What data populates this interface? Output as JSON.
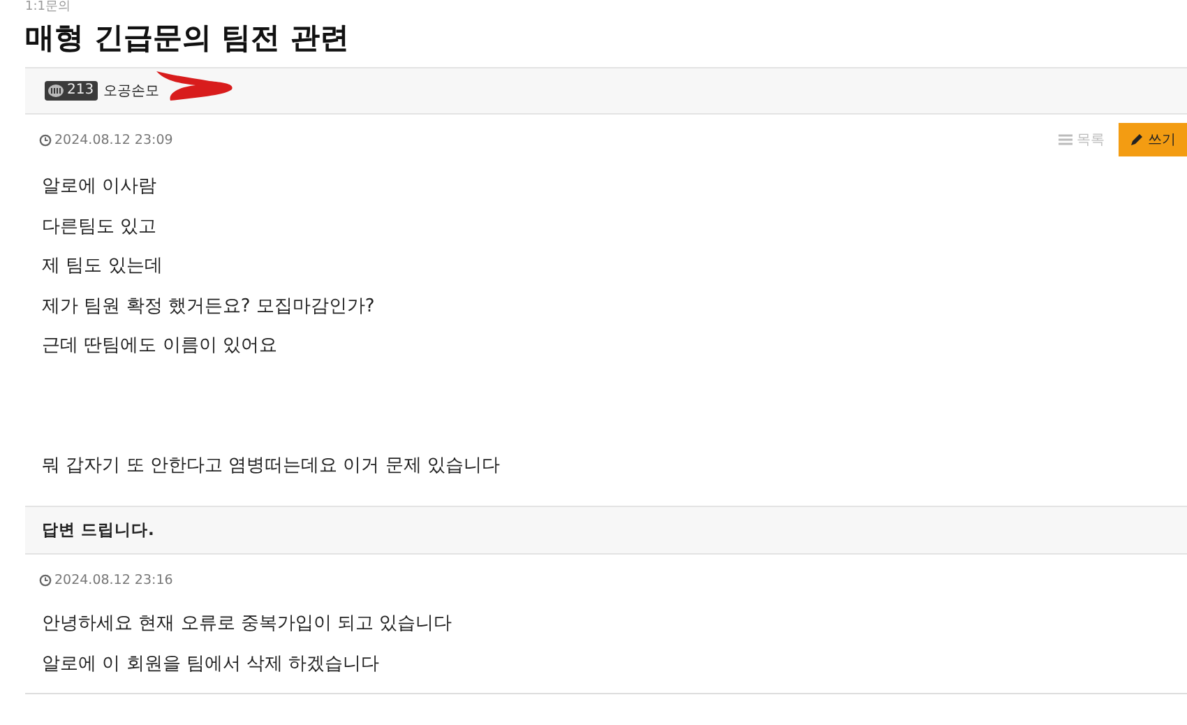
{
  "board": {
    "name": "1:1문의"
  },
  "post": {
    "title": "매형 긴급문의 팀전 관련",
    "author": {
      "level": "213",
      "name": "오공손모"
    },
    "date": "2024.08.12 23:09",
    "actions": [
      {
        "kind": "list",
        "label": "목록"
      },
      {
        "kind": "write",
        "label": "쓰기"
      }
    ],
    "blocks": [
      [
        "알로에 이사람",
        "다른팀도 있고",
        "제 팀도 있는데",
        "제가 팀원 확정 했거든요? 모집마감인가?",
        "근데 딴팀에도 이름이 있어요"
      ],
      [
        "뭐 갑자기 또 안한다고 염병떠는데요 이거 문제 있습니다"
      ]
    ]
  },
  "reply": {
    "title": "답변 드립니다.",
    "date": "2024.08.12 23:16",
    "lines": [
      "안녕하세요 현재 오류로 중복가입이 되고 있습니다",
      "알로에 이 회원을 팀에서 삭제 하겠습니다"
    ]
  }
}
